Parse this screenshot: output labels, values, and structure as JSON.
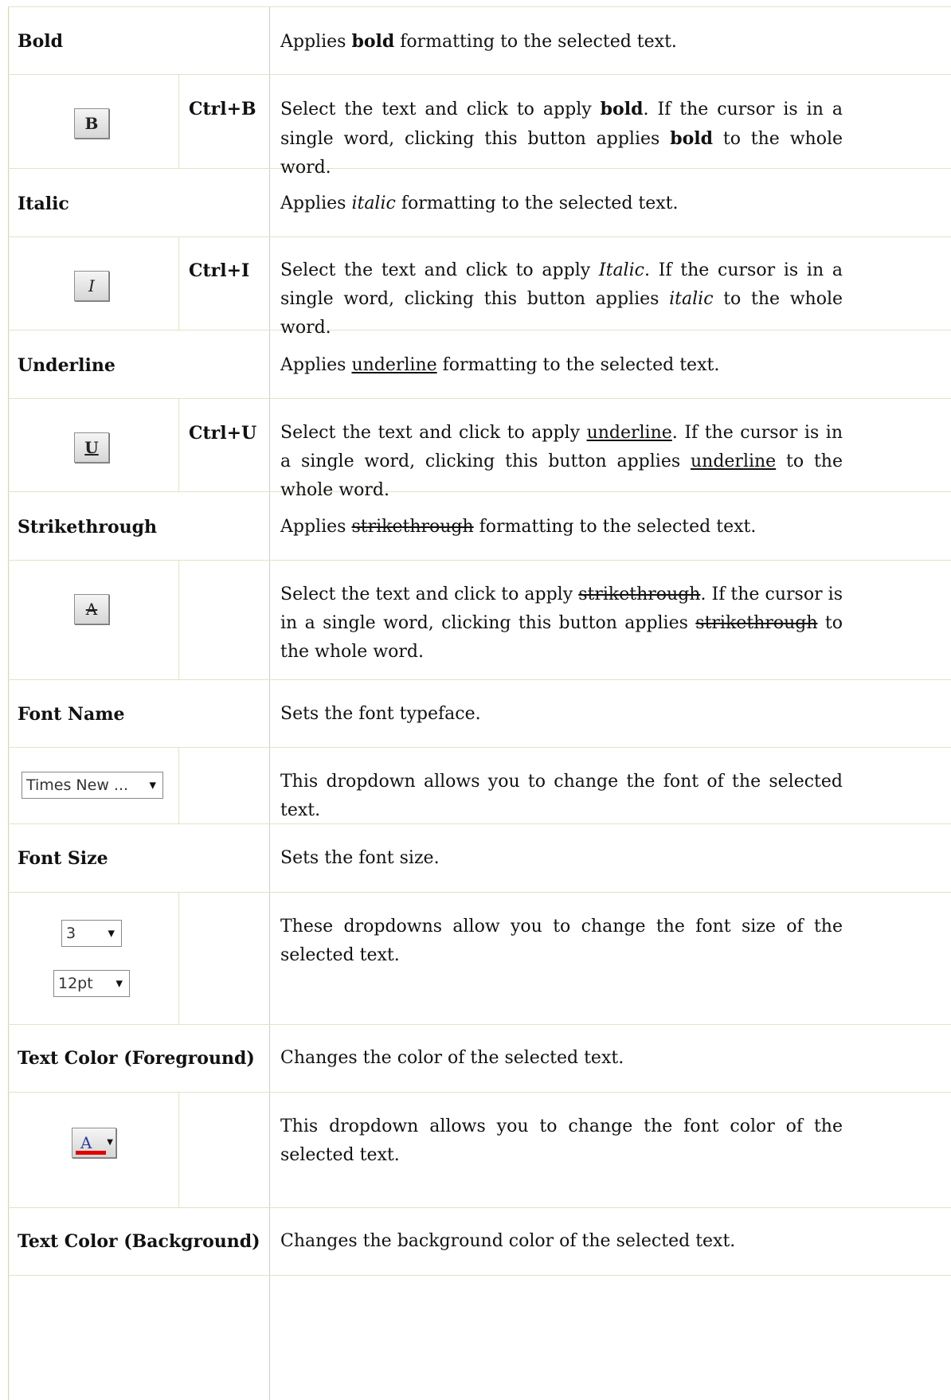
{
  "rows": [
    {
      "title": "Bold",
      "summary_parts": [
        "Applies ",
        "bold",
        " formatting to the selected text."
      ],
      "button_icon": "bold-icon",
      "button_glyph": "B",
      "shortcut": "Ctrl+B",
      "detail_parts": [
        "Select the text and click to apply ",
        "bold",
        ". If the cursor is in a single word, clicking this button applies ",
        "bold",
        " to the whole word."
      ]
    },
    {
      "title": "Italic",
      "summary_parts": [
        "Applies ",
        "italic",
        " formatting to the selected text."
      ],
      "button_icon": "italic-icon",
      "button_glyph": "I",
      "shortcut": "Ctrl+I",
      "detail_parts": [
        "Select the text and click to apply ",
        "Italic",
        ". If the cursor is in a single word, clicking this button applies ",
        "italic",
        " to the whole word."
      ]
    },
    {
      "title": "Underline",
      "summary_parts": [
        "Applies ",
        "underline",
        " formatting to the selected text."
      ],
      "button_icon": "underline-icon",
      "button_glyph": "U",
      "shortcut": "Ctrl+U",
      "detail_parts": [
        "Select the text and click to apply ",
        "underline",
        ". If the cursor is in a single word, clicking this button applies ",
        "underline",
        " to the whole word."
      ]
    },
    {
      "title": "Strikethrough",
      "summary_parts": [
        "Applies ",
        "strikethrough",
        " formatting to the selected text."
      ],
      "button_icon": "strikethrough-icon",
      "button_glyph": "A",
      "shortcut": "",
      "detail_parts": [
        "Select the text and click to apply ",
        "strikethrough",
        ". If the cursor is in a single word, clicking this button applies ",
        "strikethrough",
        " to the whole word."
      ]
    },
    {
      "title": "Font Name",
      "summary": "Sets the font typeface.",
      "dropdown_value": "Times New ...",
      "detail": "This dropdown allows you to change the font of the selected text."
    },
    {
      "title": "Font Size",
      "summary": "Sets the font size.",
      "dropdown_values": [
        "3",
        "12pt"
      ],
      "detail": "These dropdowns allow you to change the font size of the selected text."
    },
    {
      "title": "Text Color (Foreground)",
      "summary": "Changes the color of the selected text.",
      "button_icon": "font-color-icon",
      "button_glyph": "A",
      "color_bar": "#e00000",
      "detail": "This dropdown allows you to change the font color of the selected text."
    },
    {
      "title": "Text Color (Background)",
      "summary": "Changes the background color of the selected text."
    }
  ],
  "colors": {
    "grid": "#c9d7b0",
    "text": "#111111"
  }
}
